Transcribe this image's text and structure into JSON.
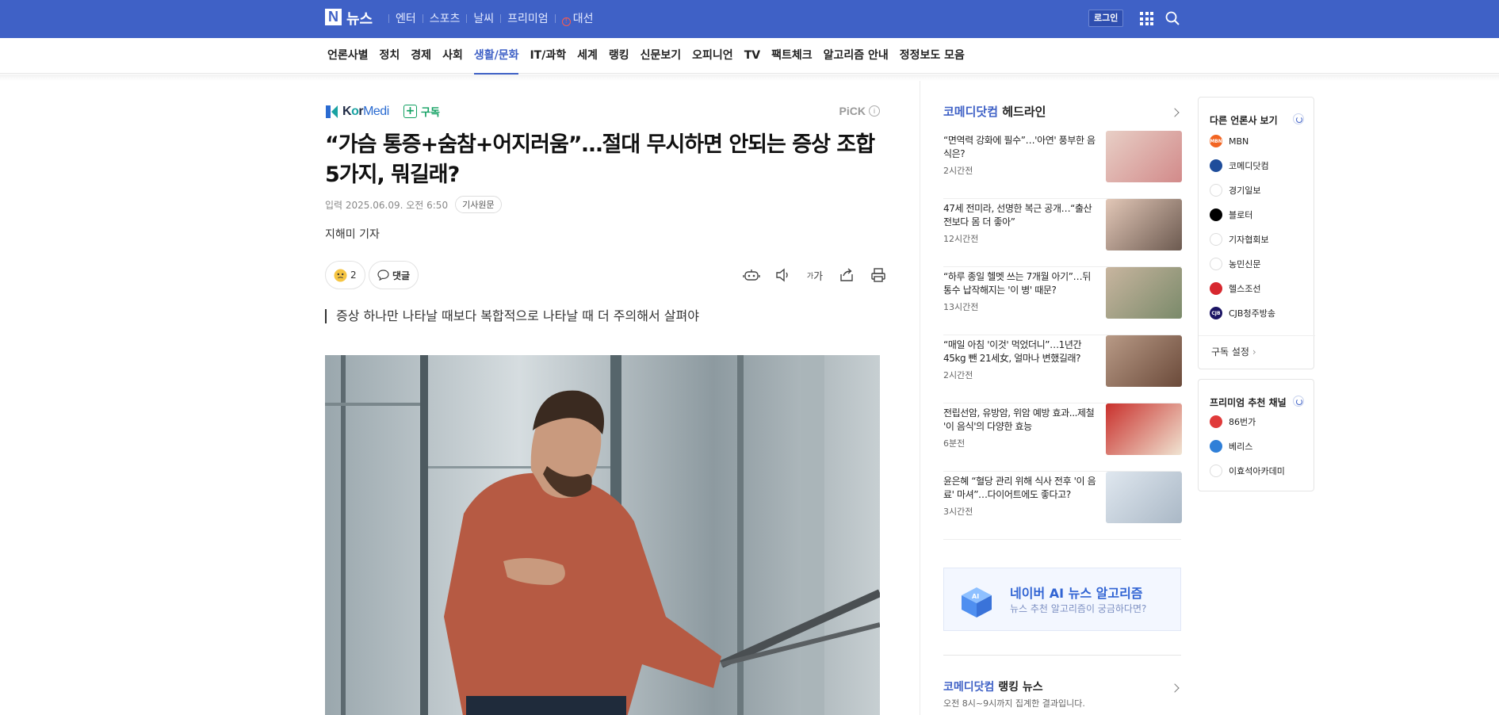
{
  "brand": {
    "logo_letter": "N",
    "logo_text": "뉴스",
    "blue": "#3f61c6"
  },
  "top_nav": {
    "items": [
      "엔터",
      "스포츠",
      "날씨",
      "프리미엄"
    ],
    "election_label": "대선",
    "login_label": "로그인"
  },
  "categories": [
    "언론사별",
    "정치",
    "경제",
    "사회",
    "생활/문화",
    "IT/과학",
    "세계",
    "랭킹",
    "신문보기",
    "오피니언",
    "TV",
    "팩트체크",
    "알고리즘 안내",
    "정정보도 모음"
  ],
  "active_category": "생활/문화",
  "article": {
    "press_name_k": "K",
    "press_name_o": "o",
    "press_name_r": "r",
    "press_name_medi": "Medi",
    "subscribe_label": "구독",
    "pick_label": "PiCK",
    "headline": "“가슴 통증+숨참+어지러움”…절대 무시하면 안되는 증상 조합 5가지, 뭐길래?",
    "date_text": "입력 2025.06.09. 오전 6:50",
    "original_label": "기사원문",
    "reporter": "지해미 기자",
    "reaction_count": "2",
    "comment_label": "댓글",
    "font_size_label": "가",
    "summary": "증상 하나만 나타날 때보다 복합적으로 나타날 때 더 주의해서 살펴야"
  },
  "headlines": {
    "press": "코메디닷컴",
    "label": "헤드라인",
    "items": [
      {
        "title": "“면역력 강화에 필수”…'아연' 풍부한 음식은?",
        "time": "2시간전"
      },
      {
        "title": "47세 전미라, 선명한 복근 공개…“출산 전보다 몸 더 좋아”",
        "time": "12시간전"
      },
      {
        "title": "“하루 종일 헬멧 쓰는 7개월 아기”…뒤통수 납작해지는 '이 병' 때문?",
        "time": "13시간전"
      },
      {
        "title": "“매일 아침 '이것' 먹었더니”…1년간 45kg 뺀 21세女, 얼마나 변했길래?",
        "time": "2시간전"
      },
      {
        "title": "전립선암, 유방암, 위암 예방 효과...제철 '이 음식'의 다양한 효능",
        "time": "6분전"
      },
      {
        "title": "윤은혜 “혈당 관리 위해 식사 전후 '이 음료' 마셔”…다이어트에도 좋다고?",
        "time": "3시간전"
      }
    ]
  },
  "ai_banner": {
    "title": "네이버 AI 뉴스 알고리즘",
    "subtitle": "뉴스 추천 알고리즘이 궁금하다면?",
    "badge": "AI"
  },
  "ranking": {
    "press": "코메디닷컴",
    "label": "랭킹 뉴스",
    "subtitle": "오전 8시~9시까지 집계한 결과입니다."
  },
  "other_press": {
    "title": "다른 언론사 보기",
    "items": [
      {
        "name": "MBN",
        "color": "#f26522",
        "mark": "MBN"
      },
      {
        "name": "코메디닷컴",
        "color": "#1e4d9b",
        "mark": ""
      },
      {
        "name": "경기일보",
        "color": "#ffffff",
        "mark": ""
      },
      {
        "name": "블로터",
        "color": "#000000",
        "mark": ""
      },
      {
        "name": "기자협회보",
        "color": "#ffffff",
        "mark": ""
      },
      {
        "name": "농민신문",
        "color": "#ffffff",
        "mark": ""
      },
      {
        "name": "헬스조선",
        "color": "#d7282f",
        "mark": ""
      },
      {
        "name": "CJB청주방송",
        "color": "#1b1464",
        "mark": "CJB"
      }
    ],
    "settings_label": "구독 설정"
  },
  "premium": {
    "title": "프리미엄 추천 채널",
    "items": [
      {
        "name": "86번가",
        "color": "#e03a3a"
      },
      {
        "name": "베리스",
        "color": "#2f7fd8"
      },
      {
        "name": "이효석아카데미",
        "color": "#ffffff"
      }
    ]
  }
}
